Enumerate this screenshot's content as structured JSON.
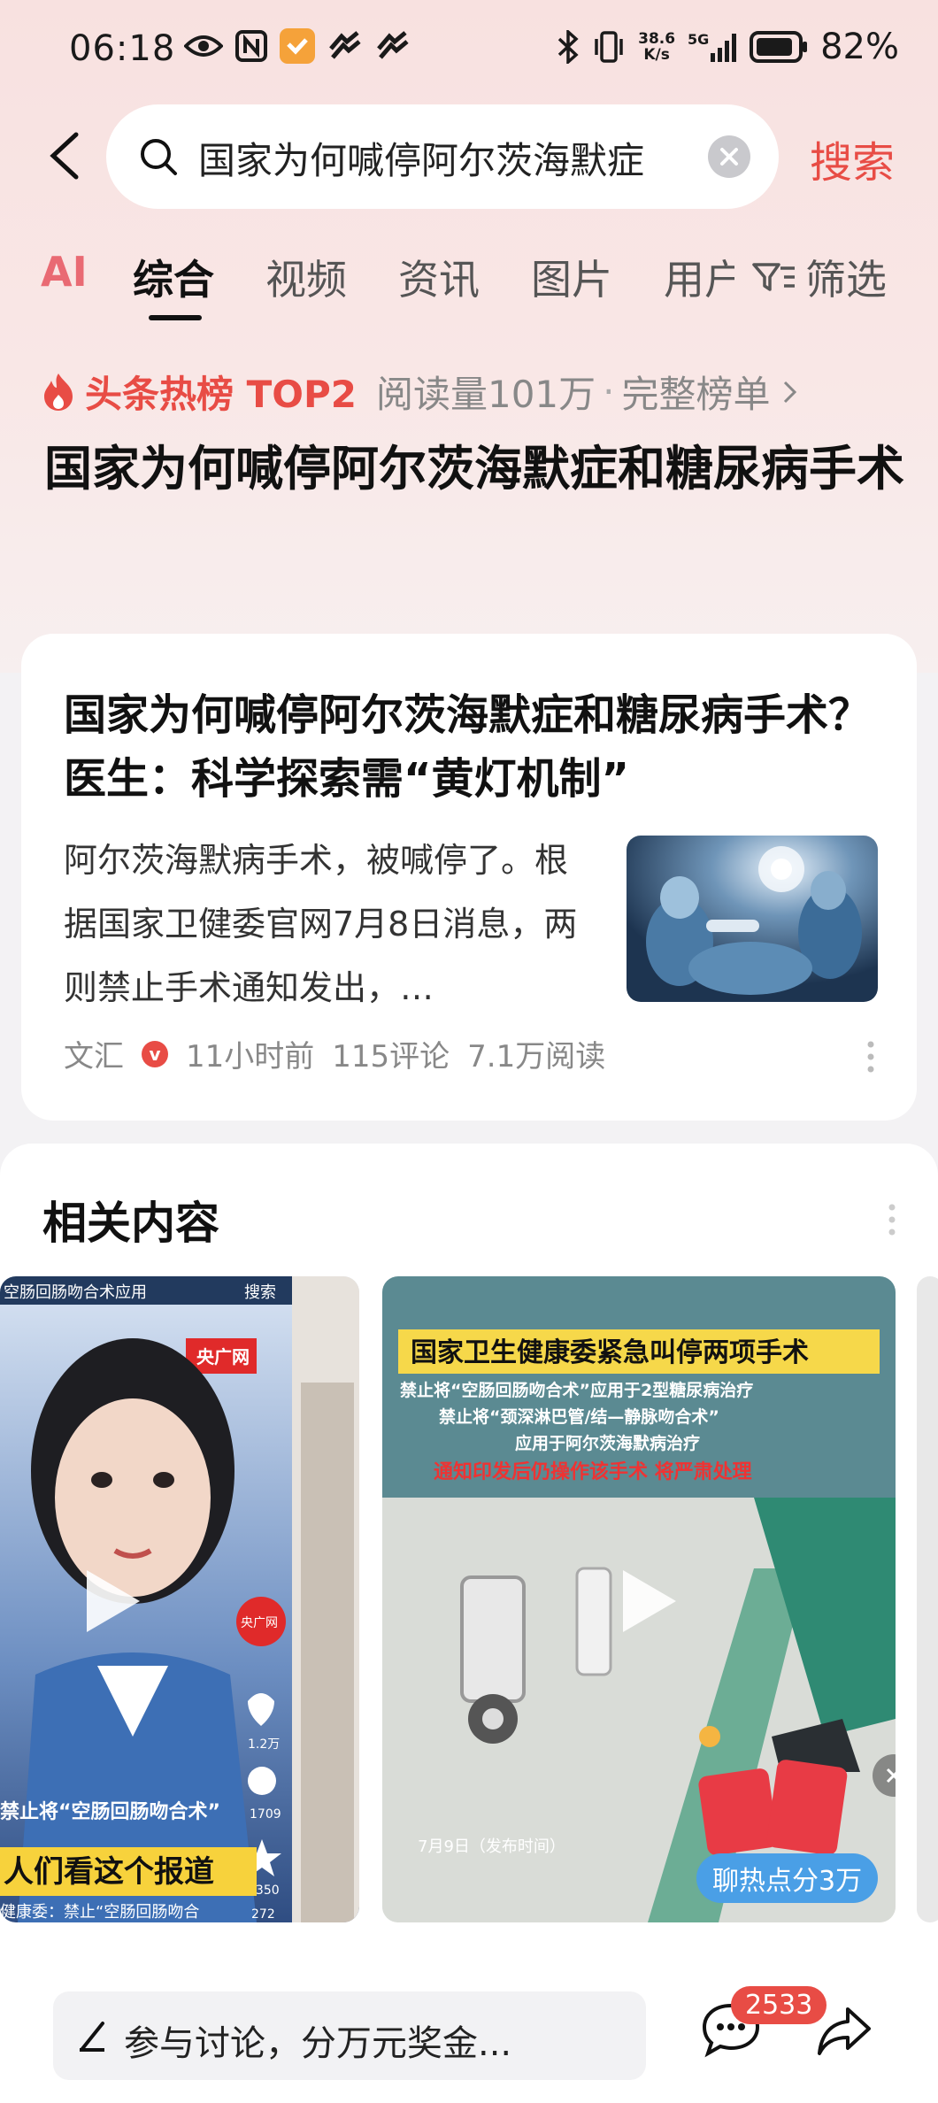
{
  "status_bar": {
    "time": "06:18",
    "net_speed_top": "38.6",
    "net_speed_bottom": "K/s",
    "signal": "5G",
    "battery": "82%"
  },
  "search": {
    "query": "国家为何喊停阿尔茨海默症",
    "search_label": "搜索"
  },
  "tabs": [
    {
      "label": "AI"
    },
    {
      "label": "综合"
    },
    {
      "label": "视频"
    },
    {
      "label": "资讯"
    },
    {
      "label": "图片"
    },
    {
      "label": "用户"
    },
    {
      "label": "筛选"
    }
  ],
  "hot_rank": {
    "label": "头条热榜 TOP2",
    "reads": "阅读量101万",
    "separator": "·",
    "full_list": "完整榜单",
    "headline": "国家为何喊停阿尔茨海默症和糖尿病手术"
  },
  "article": {
    "title": "国家为何喊停阿尔茨海默症和糖尿病手术？医生：科学探索需“黄灯机制”",
    "summary": "阿尔茨海默病手术，被喊停了。根据国家卫健委官网7月8日消息，两则禁止手术通知发出，…",
    "source": "文汇",
    "verified_mark": "v",
    "time": "11小时前",
    "comments": "115评论",
    "reads": "7.1万阅读"
  },
  "related": {
    "title": "相关内容",
    "video1": {
      "top_left": "空肠回肠吻合术应用",
      "top_right": "搜索",
      "logo": "央广网",
      "side_logo": "央广网",
      "likes": "1.2万",
      "comments": "1709",
      "favorites": "2350",
      "shares": "272",
      "caption1": "禁止将“空肠回肠吻合术”",
      "caption2": "人们看这个报道",
      "caption3": "健康委：禁止“空肠回肠吻合"
    },
    "video2": {
      "headline": "国家卫生健康委紧急叫停两项手术",
      "line1": "禁止将“空肠回肠吻合术”应用于2型糖尿病治疗",
      "line2": "禁止将“颈深淋巴管/结—静脉吻合术”",
      "line3": "应用于阿尔茨海默病治疗",
      "line4": "通知印发后仍操作该手术 将严肃处理",
      "date_note": "7月9日（发布时间）",
      "promo": "聊热点分3万"
    }
  },
  "bottom_bar": {
    "comment_placeholder": "参与讨论，分万元奖金...",
    "comment_count": "2533"
  }
}
